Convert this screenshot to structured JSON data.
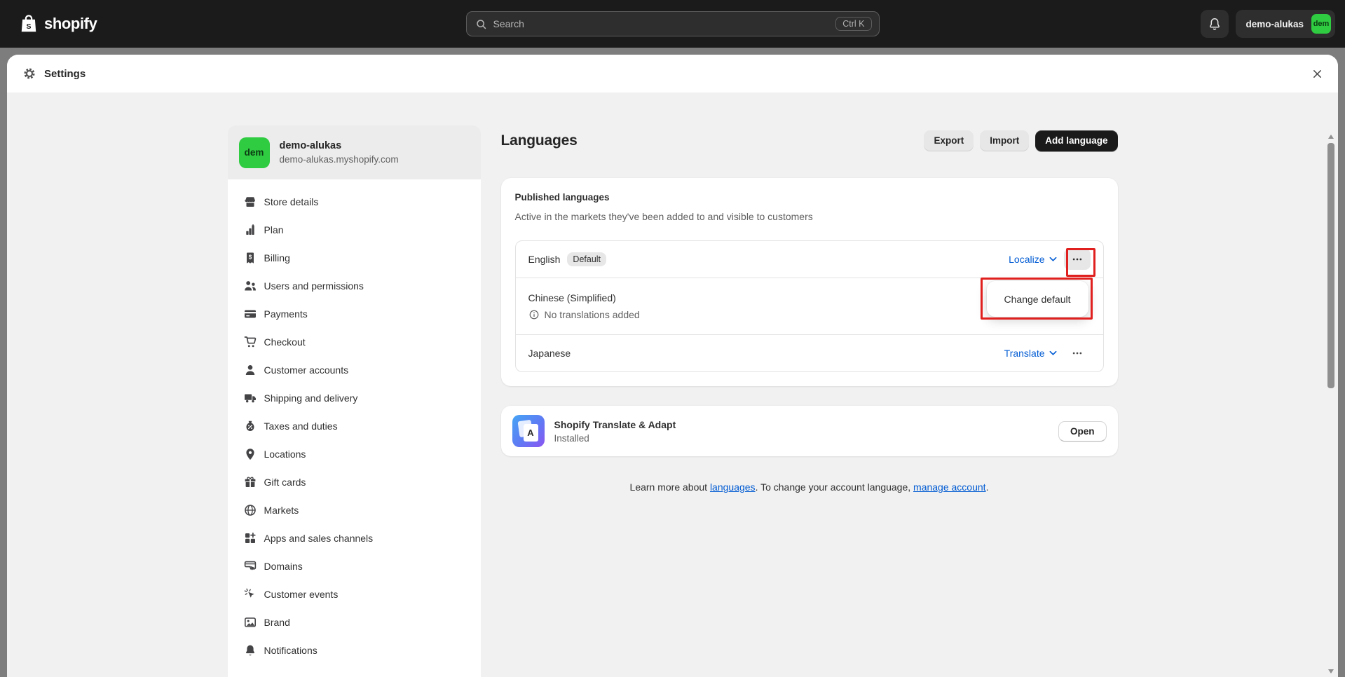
{
  "topbar": {
    "logo_text": "shopify",
    "search": {
      "placeholder": "Search",
      "shortcut": "Ctrl K"
    },
    "account": {
      "store_name": "demo-alukas",
      "avatar_initials": "dem"
    }
  },
  "modal": {
    "title": "Settings"
  },
  "sidebar": {
    "store": {
      "initials": "dem",
      "name": "demo-alukas",
      "domain": "demo-alukas.myshopify.com"
    },
    "items": [
      {
        "label": "Store details",
        "icon": "store"
      },
      {
        "label": "Plan",
        "icon": "plan"
      },
      {
        "label": "Billing",
        "icon": "billing"
      },
      {
        "label": "Users and permissions",
        "icon": "users"
      },
      {
        "label": "Payments",
        "icon": "payments"
      },
      {
        "label": "Checkout",
        "icon": "checkout"
      },
      {
        "label": "Customer accounts",
        "icon": "person"
      },
      {
        "label": "Shipping and delivery",
        "icon": "truck"
      },
      {
        "label": "Taxes and duties",
        "icon": "tax"
      },
      {
        "label": "Locations",
        "icon": "pin"
      },
      {
        "label": "Gift cards",
        "icon": "gift"
      },
      {
        "label": "Markets",
        "icon": "globe"
      },
      {
        "label": "Apps and sales channels",
        "icon": "apps"
      },
      {
        "label": "Domains",
        "icon": "domains"
      },
      {
        "label": "Customer events",
        "icon": "cursor"
      },
      {
        "label": "Brand",
        "icon": "image"
      },
      {
        "label": "Notifications",
        "icon": "bellnav"
      }
    ]
  },
  "main": {
    "title": "Languages",
    "actions": {
      "export": "Export",
      "import": "Import",
      "add_language": "Add language"
    },
    "published": {
      "title": "Published languages",
      "subtitle": "Active in the markets they've been added to and visible to customers",
      "rows": [
        {
          "name": "English",
          "badge": "Default",
          "action": "Localize"
        },
        {
          "name": "Chinese (Simplified)",
          "note": "No translations added"
        },
        {
          "name": "Japanese",
          "action": "Translate"
        }
      ],
      "popup": {
        "label": "Change default"
      }
    },
    "app_card": {
      "title": "Shopify Translate & Adapt",
      "status": "Installed",
      "action": "Open",
      "icon_letter": "A"
    },
    "footer": {
      "text_before": "Learn more about ",
      "link_languages": "languages",
      "text_middle": ". To change your account language, ",
      "link_manage": "manage account",
      "text_after": "."
    }
  },
  "colors": {
    "accent_green": "#2fcb41",
    "annotation_red": "#e0201e",
    "link_blue": "#005bd3",
    "dark_button": "#1a1a1a",
    "topbar_bg": "#1b1b1b",
    "modal_body_bg": "#f1f1f1"
  }
}
